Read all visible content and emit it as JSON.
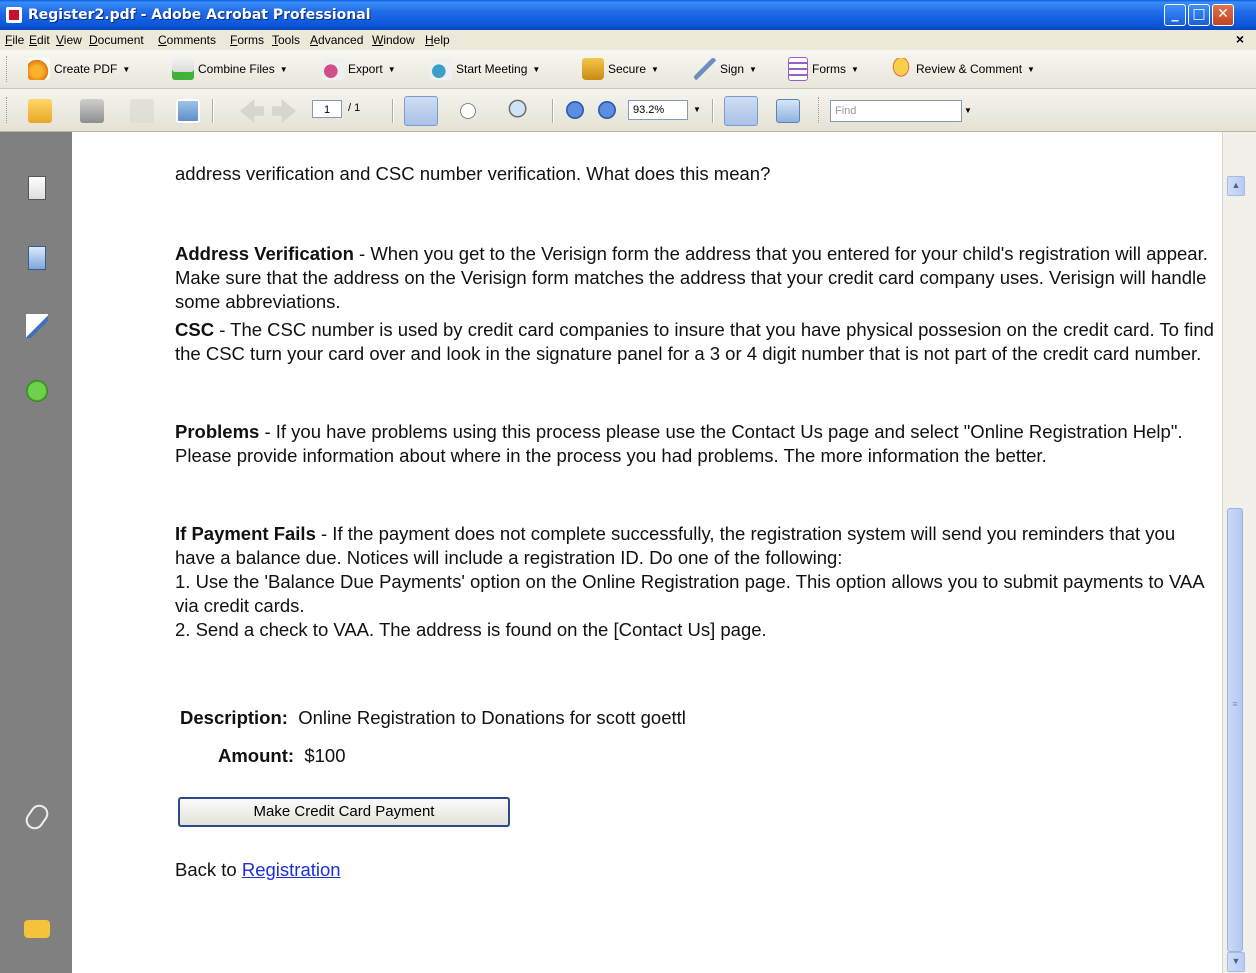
{
  "window": {
    "title": "Register2.pdf - Adobe Acrobat Professional",
    "controls": {
      "minimize": "_",
      "maximize": "□",
      "close": "✕"
    }
  },
  "menu": {
    "items": [
      "File",
      "Edit",
      "View",
      "Document",
      "Comments",
      "Forms",
      "Tools",
      "Advanced",
      "Window",
      "Help"
    ],
    "doc_close": "×"
  },
  "toolbar1": {
    "buttons": [
      {
        "label": "Create PDF",
        "icon": "create-pdf-icon"
      },
      {
        "label": "Combine Files",
        "icon": "combine-files-icon"
      },
      {
        "label": "Export",
        "icon": "export-icon"
      },
      {
        "label": "Start Meeting",
        "icon": "start-meeting-icon"
      },
      {
        "label": "Secure",
        "icon": "lock-icon"
      },
      {
        "label": "Sign",
        "icon": "pen-icon"
      },
      {
        "label": "Forms",
        "icon": "forms-icon"
      },
      {
        "label": "Review & Comment",
        "icon": "review-comment-icon"
      }
    ],
    "dropdown_glyph": "▼"
  },
  "toolbar2": {
    "page_current": "1",
    "page_total": "/ 1",
    "zoom": "93.2%",
    "find_placeholder": "Find"
  },
  "document": {
    "para0": "address verification and CSC number verification. What does this mean?",
    "address": {
      "heading": "Address Verification",
      "text": " - When you get to the Verisign form the address that you entered for your child's registration will appear. Make sure that the address on the Verisign form matches the address that your credit card company uses. Verisign will handle some abbreviations."
    },
    "csc": {
      "heading": "CSC",
      "text": " - The CSC number is used by credit card companies to insure that you have physical possesion on the credit card. To find the CSC turn your card over and look in the signature panel for a 3 or 4 digit number that is not part of the credit card number."
    },
    "problems": {
      "heading": "Problems",
      "text": " - If you have problems using this process please use the Contact Us page and select \"Online Registration Help\". Please provide information about where in the process you had problems. The more information the better."
    },
    "fails": {
      "heading": "If Payment Fails",
      "text": " - If the payment does not complete successfully, the registration system will send you reminders that you have a balance due.  Notices will include a registration ID.  Do one of the following:",
      "step1": "1. Use the 'Balance Due Payments' option on the Online Registration page.  This option allows you to submit payments to VAA via credit cards.",
      "step2": "2. Send a check to VAA. The address is found on the [Contact Us] page."
    },
    "description_label": "Description:",
    "description_value": "Online Registration to Donations for scott goettl",
    "amount_label": "Amount:",
    "amount_value": "$100",
    "pay_button": "Make Credit Card Payment",
    "back_text": "Back to ",
    "back_link": "Registration"
  },
  "scrollbar": {
    "up": "▲",
    "down": "▼",
    "thumb_grip": "≡"
  }
}
